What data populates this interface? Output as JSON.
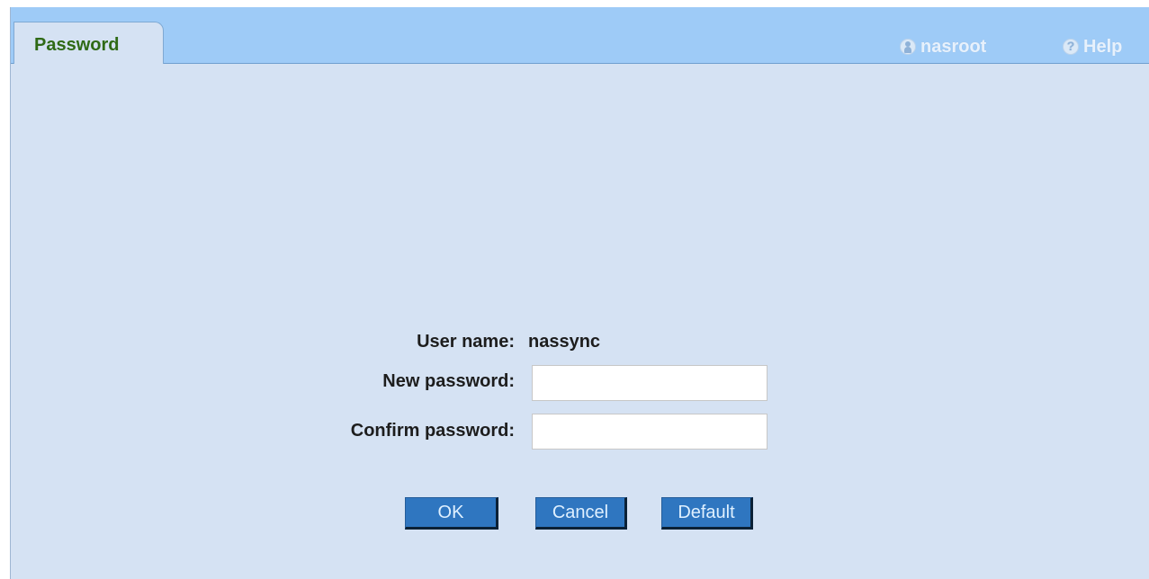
{
  "tab": {
    "label": "Password"
  },
  "top_links": {
    "user": {
      "label": "nasroot",
      "icon": "user-icon"
    },
    "help": {
      "label": "Help",
      "icon": "help-icon"
    }
  },
  "form": {
    "username_label": "User name:",
    "username_value": "nassync",
    "new_password_label": "New password:",
    "new_password_value": "",
    "confirm_password_label": "Confirm password:",
    "confirm_password_value": ""
  },
  "buttons": {
    "ok": "OK",
    "cancel": "Cancel",
    "default": "Default"
  },
  "colors": {
    "top_bar": "#9ecbf7",
    "panel": "#d5e2f3",
    "tab_text": "#2f6a16",
    "button": "#2f76c0"
  }
}
